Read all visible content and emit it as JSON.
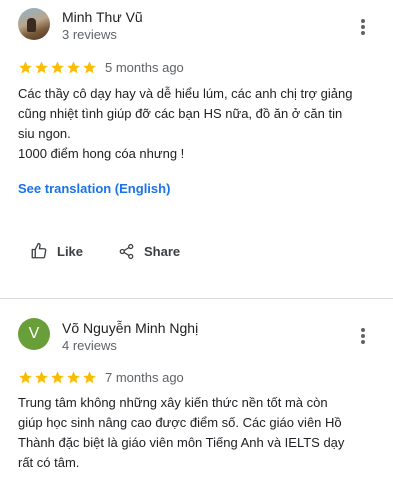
{
  "reviews": [
    {
      "reviewer_name": "Minh Thư Vũ",
      "review_count": "3 reviews",
      "avatar_type": "photo",
      "rating": 5,
      "time": "5 months ago",
      "text_lines": [
        "Các thầy cô dạy hay và dễ hiểu lúm, các anh chị trợ giảng",
        "cũng nhiệt tình giúp đỡ các bạn HS nữa, đồ ăn ở căn tin",
        "siu ngon.",
        "1000 điểm hong cóa nhưng !"
      ],
      "translation_link": "See translation (English)",
      "actions": {
        "like": "Like",
        "share": "Share"
      }
    },
    {
      "reviewer_name": "Võ Nguyễn Minh Nghị",
      "review_count": "4 reviews",
      "avatar_letter": "V",
      "avatar_color": "#689f38",
      "rating": 5,
      "time": "7 months ago",
      "text_lines": [
        "Trung tâm không những xây kiến thức nền tốt mà còn",
        "giúp học sinh nâng cao được điểm số. Các giáo viên Hồ",
        "Thành đặc biệt là giáo viên môn Tiếng Anh và IELTS dạy",
        "rất có tâm."
      ]
    }
  ],
  "colors": {
    "star": "#fbbc04",
    "link": "#1a73e8",
    "secondary_text": "#5f6368"
  },
  "icons": {
    "menu": "more-vert-icon",
    "like": "thumb-up-icon",
    "share": "share-icon",
    "star": "star-icon"
  }
}
